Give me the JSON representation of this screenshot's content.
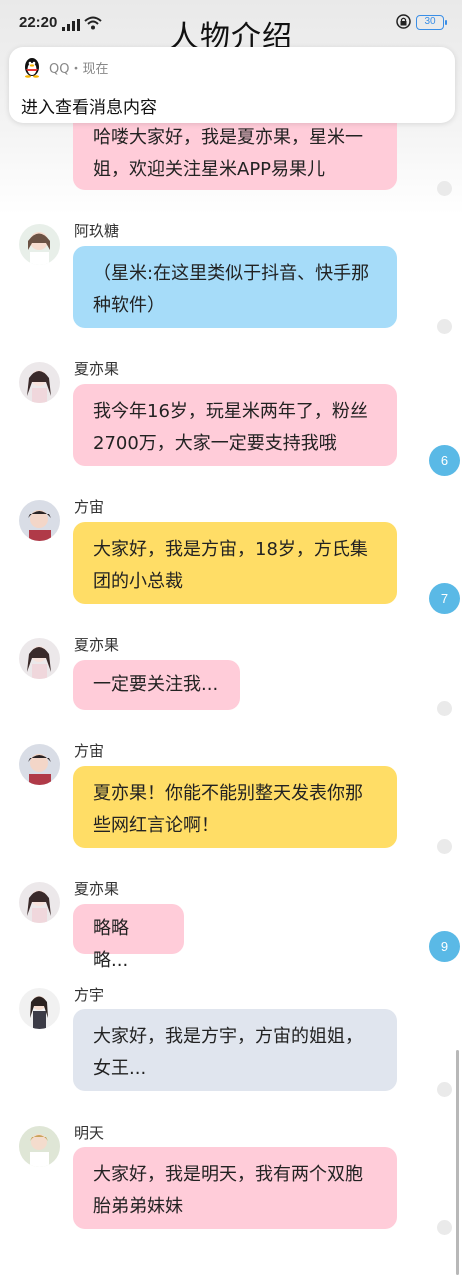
{
  "status_bar": {
    "time": "22:20",
    "battery": "30"
  },
  "header": {
    "title": "人物介绍"
  },
  "notification": {
    "app": "QQ・现在",
    "body": "进入查看消息内容"
  },
  "messages": [
    {
      "name": "",
      "text": "哈喽大家好，我是夏亦果，星米一姐，欢迎关注星米APP易果儿",
      "color": "#ffccd9"
    },
    {
      "name": "阿玖糖",
      "text": "（星米:在这里类似于抖音、快手那种软件）",
      "color": "#a6dcf9"
    },
    {
      "name": "夏亦果",
      "text": "我今年16岁，玩星米两年了，粉丝2700万，大家一定要支持我哦",
      "color": "#ffccd9",
      "badge": "6"
    },
    {
      "name": "方宙",
      "text": "大家好，我是方宙，18岁，方氏集团的小总裁",
      "color": "#ffdd66",
      "badge": "7"
    },
    {
      "name": "夏亦果",
      "text": "一定要关注我...",
      "color": "#ffccd9"
    },
    {
      "name": "方宙",
      "text": "夏亦果！你能不能别整天发表你那些网红言论啊！",
      "color": "#ffdd66"
    },
    {
      "name": "夏亦果",
      "text": "略略略...",
      "color": "#ffccd9",
      "badge": "9"
    },
    {
      "name": "方宇",
      "text": "大家好，我是方宇，方宙的姐姐，女王...",
      "color": "#e0e5ee"
    },
    {
      "name": "明天",
      "text": "大家好，我是明天，我有两个双胞胎弟弟妹妹",
      "color": "#ffccd9"
    }
  ]
}
